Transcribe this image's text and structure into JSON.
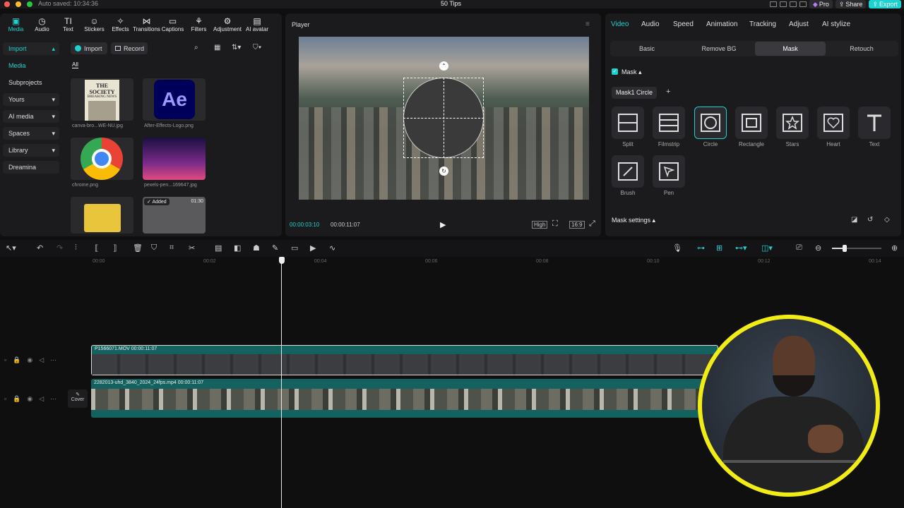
{
  "titlebar": {
    "autosave": "Auto saved: 10:34:36",
    "project": "50 Tips",
    "pro": "Pro",
    "share": "Share",
    "export": "Export"
  },
  "toolbar": [
    "Media",
    "Audio",
    "Text",
    "Stickers",
    "Effects",
    "Transitions",
    "Captions",
    "Filters",
    "Adjustment",
    "AI avatar"
  ],
  "sidebar": [
    "Import",
    "Media",
    "Subprojects",
    "Yours",
    "AI media",
    "Spaces",
    "Library",
    "Dreamina"
  ],
  "media": {
    "import_btn": "Import",
    "record_btn": "Record",
    "filter_all": "All",
    "items": [
      {
        "name": "canva-bro...WE-NU.jpg"
      },
      {
        "name": "After-Effects-Logo.png",
        "logo": "Ae"
      },
      {
        "name": "chrome.png"
      },
      {
        "name": "pexels-pen...169647.jpg"
      },
      {
        "name": ""
      },
      {
        "name": "",
        "badge": "Added",
        "duration": "01:30"
      }
    ],
    "newspaper": {
      "title": "THE SOCIETY",
      "sub": "BREAKING NEWS"
    }
  },
  "player": {
    "title": "Player",
    "current_time": "00:00:03:10",
    "total_time": "00:00:11:07",
    "quality": "High",
    "ratio": "16:9"
  },
  "inspector": {
    "tabs": [
      "Video",
      "Audio",
      "Speed",
      "Animation",
      "Tracking",
      "Adjust",
      "AI stylize"
    ],
    "subtabs": [
      "Basic",
      "Remove BG",
      "Mask",
      "Retouch"
    ],
    "mask_label": "Mask",
    "mask_chip": "Mask1 Circle",
    "shapes": [
      "Split",
      "Filmstrip",
      "Circle",
      "Rectangle",
      "Stars",
      "Heart",
      "Text",
      "Brush",
      "Pen"
    ],
    "mask_settings": "Mask settings"
  },
  "timeline": {
    "ruler": [
      "00:00",
      "00:02",
      "00:04",
      "00:06",
      "00:08",
      "00:10",
      "00:12",
      "00:14"
    ],
    "clip1": {
      "name": "P1566071.MOV",
      "duration": "00:00:11:07"
    },
    "clip2": {
      "name": "2282013-uhd_3840_2024_24fps.mp4",
      "duration": "00:00:11:07"
    },
    "cover": "Cover"
  }
}
